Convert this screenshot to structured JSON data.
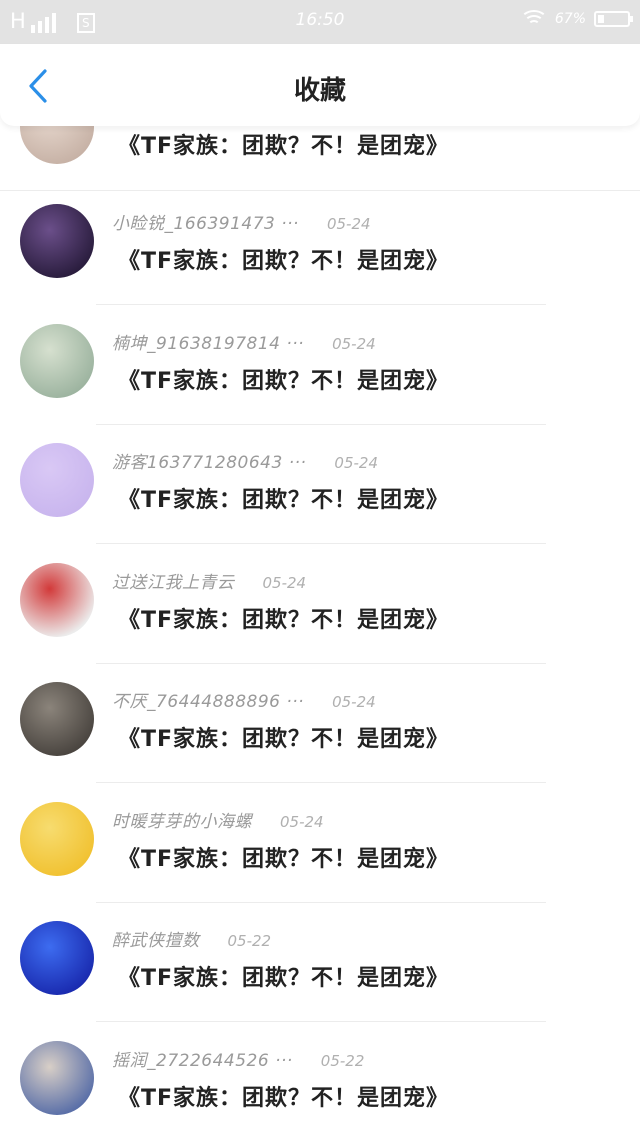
{
  "status_bar": {
    "network": "H",
    "time": "16:50",
    "battery": "67%"
  },
  "header": {
    "title": "收藏",
    "back_icon": "chevron-left-icon"
  },
  "items": [
    {
      "user": "",
      "date": "",
      "title": "《TF家族：团欺？不！是团宠》",
      "avatar_colors": [
        "#c7b2a6",
        "#e8d9cf"
      ]
    },
    {
      "user": "小睑锐_166391473 ···",
      "date": "05-24",
      "title": "《TF家族：团欺？不！是团宠》",
      "avatar_colors": [
        "#2a1d3e",
        "#6b4f8a"
      ]
    },
    {
      "user": "楠坤_91638197814 ···",
      "date": "05-24",
      "title": "《TF家族：团欺？不！是团宠》",
      "avatar_colors": [
        "#9db4a0",
        "#d6e0cf"
      ]
    },
    {
      "user": "游客163771280643 ···",
      "date": "05-24",
      "title": "《TF家族：团欺？不！是团宠》",
      "avatar_colors": [
        "#c9b6ee",
        "#d9c8f5"
      ]
    },
    {
      "user": "过送江我上青云",
      "date": "05-24",
      "title": "《TF家族：团欺？不！是团宠》",
      "avatar_colors": [
        "#ececec",
        "#d23a3a"
      ]
    },
    {
      "user": "不厌_76444888896 ···",
      "date": "05-24",
      "title": "《TF家族：团欺？不！是团宠》",
      "avatar_colors": [
        "#4a4540",
        "#8b847b"
      ]
    },
    {
      "user": "时暖芽芽的小海螺",
      "date": "05-24",
      "title": "《TF家族：团欺？不！是团宠》",
      "avatar_colors": [
        "#f1c232",
        "#f7dc6f"
      ]
    },
    {
      "user": "醉武侠擅数",
      "date": "05-22",
      "title": "《TF家族：团欺？不！是团宠》",
      "avatar_colors": [
        "#1a2bb0",
        "#3d6cf0"
      ]
    },
    {
      "user": "摇润_2722644526 ···",
      "date": "05-22",
      "title": "《TF家族：团欺？不！是团宠》",
      "avatar_colors": [
        "#5a6fa8",
        "#d8cfc7"
      ]
    }
  ]
}
